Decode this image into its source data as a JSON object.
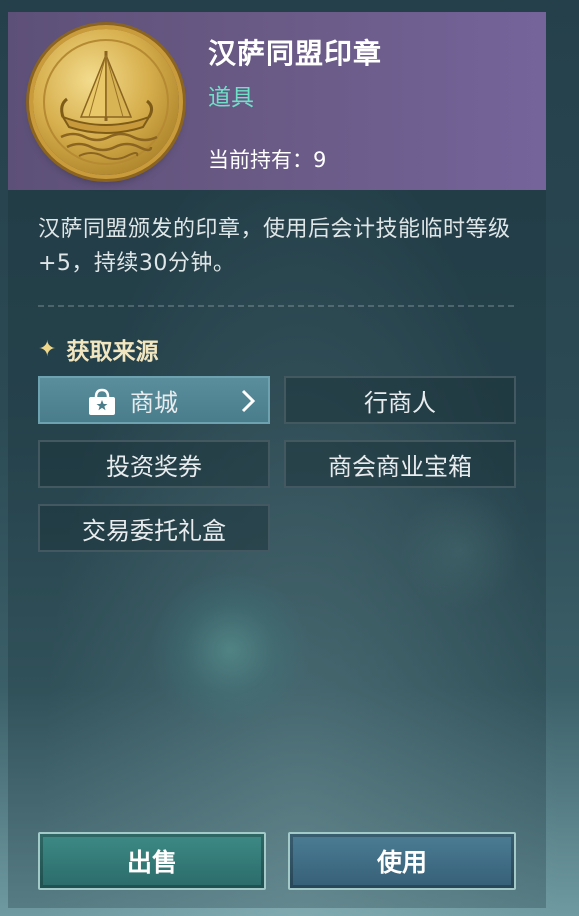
{
  "item": {
    "name": "汉萨同盟印章",
    "type": "道具",
    "owned_label": "当前持有：",
    "owned_count": "9",
    "description": "汉萨同盟颁发的印章，使用后会计技能临时等级+5，持续30分钟。",
    "icon": "viking-ship-coin-icon"
  },
  "sources": {
    "title": "获取来源",
    "title_icon": "sparkle-icon",
    "items": [
      {
        "label": "商城",
        "icon": "shop-bag-icon",
        "active": true
      },
      {
        "label": "行商人"
      },
      {
        "label": "投资奖券"
      },
      {
        "label": "商会商业宝箱"
      },
      {
        "label": "交易委托礼盒"
      }
    ]
  },
  "actions": {
    "sell": "出售",
    "use": "使用"
  },
  "colors": {
    "header": "#6a5a86",
    "type_text": "#6fe0c8",
    "active_source": "#5a8e9c",
    "sell_button": "#3d8a86",
    "use_button": "#4b7d95"
  }
}
